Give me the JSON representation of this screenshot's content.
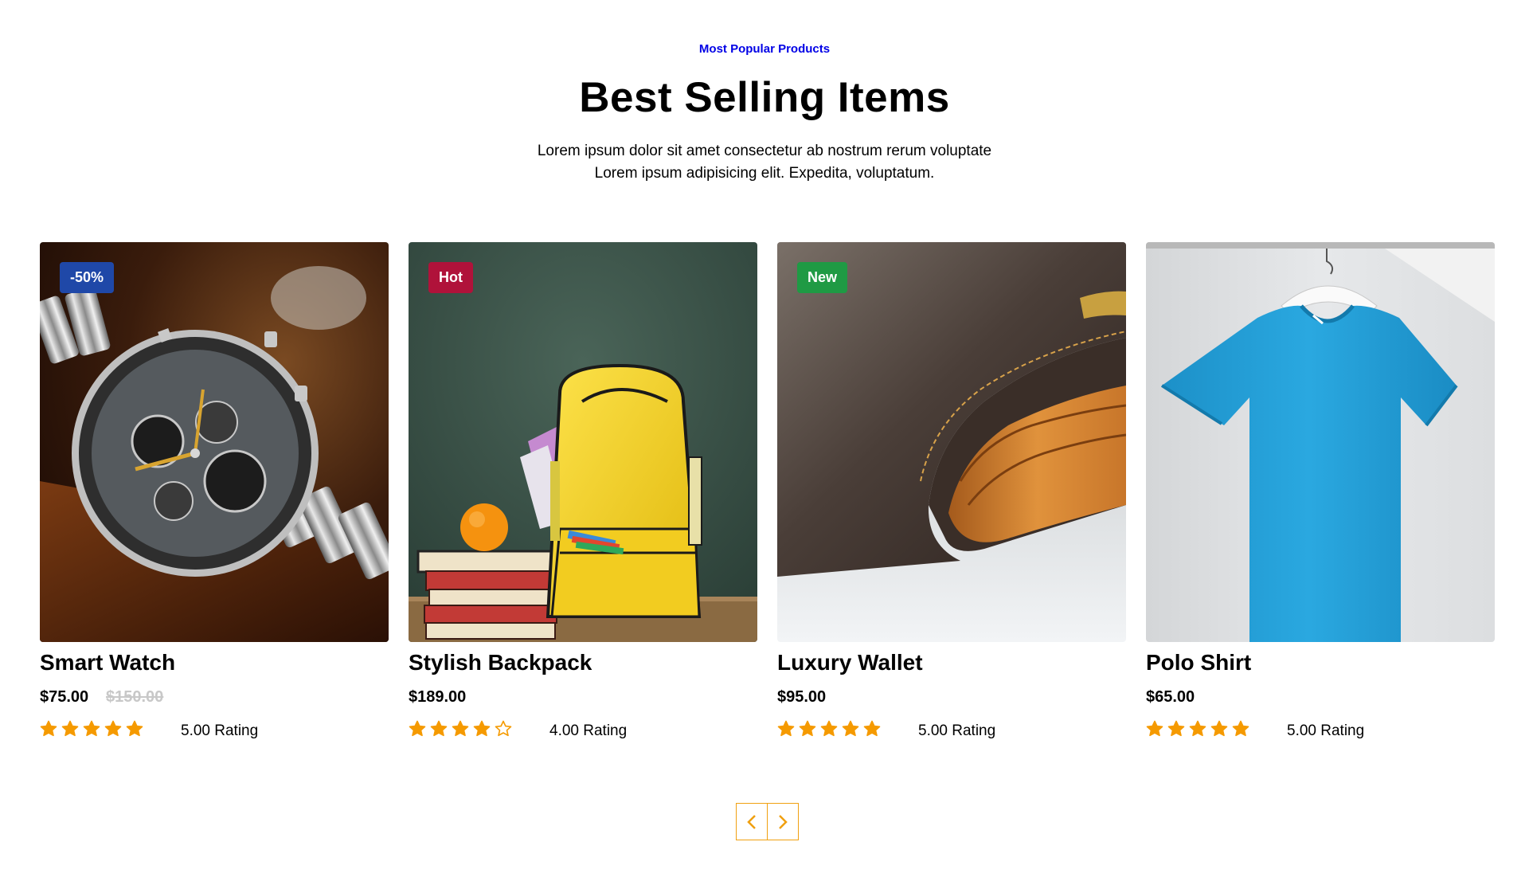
{
  "section": {
    "eyebrow": "Most Popular Products",
    "title": "Best Selling Items",
    "description": "Lorem ipsum dolor sit amet consectetur ab nostrum rerum voluptate Lorem ipsum adipisicing elit. Expedita, voluptatum."
  },
  "products": [
    {
      "name": "Smart Watch",
      "price": "$75.00",
      "old_price": "$150.00",
      "badge": "-50%",
      "badge_color": "#1f48a8",
      "rating_value": 5,
      "rating_text": "5.00 Rating",
      "image": "smart-watch-image"
    },
    {
      "name": "Stylish Backpack",
      "price": "$189.00",
      "badge": "Hot",
      "badge_color": "#b0123a",
      "rating_value": 4,
      "rating_text": "4.00 Rating",
      "image": "backpack-image"
    },
    {
      "name": "Luxury Wallet",
      "price": "$95.00",
      "badge": "New",
      "badge_color": "#1f9a44",
      "rating_value": 5,
      "rating_text": "5.00 Rating",
      "image": "wallet-image"
    },
    {
      "name": "Polo Shirt",
      "price": "$65.00",
      "rating_value": 5,
      "rating_text": "5.00 Rating",
      "image": "polo-shirt-image"
    }
  ],
  "pager": {
    "prev_icon": "chevron-left-icon",
    "next_icon": "chevron-right-icon"
  },
  "colors": {
    "accent": "#f0a010",
    "star": "#f59a00",
    "eyebrow": "#0000e6"
  }
}
